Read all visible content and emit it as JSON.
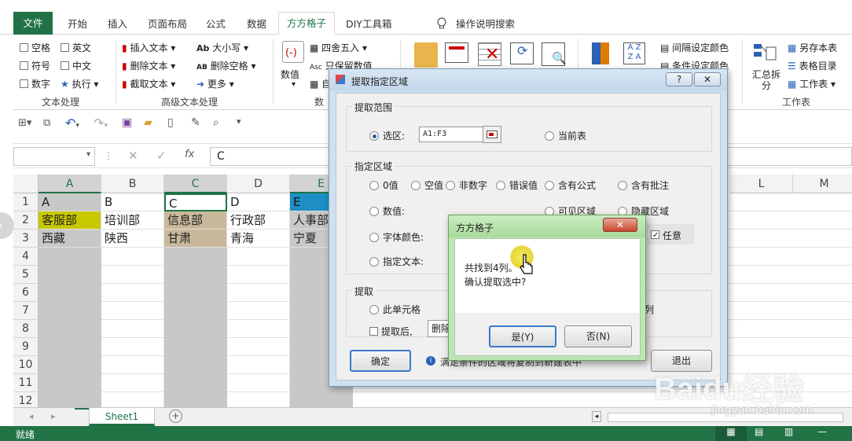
{
  "ribbon_tabs": {
    "file": "文件",
    "home": "开始",
    "insert": "插入",
    "layout": "页面布局",
    "formula": "公式",
    "data": "数据",
    "active": "方方格子",
    "diy": "DIY工具箱",
    "search": "操作说明搜索"
  },
  "ribbon": {
    "text_proc": {
      "space": "空格",
      "english": "英文",
      "symbol": "符号",
      "chinese": "中文",
      "number": "数字",
      "execute": "执行",
      "label": "文本处理"
    },
    "adv_text": {
      "insert_text": "插入文本",
      "delete_text": "删除文本",
      "cut_text": "截取文本",
      "case": "大小写",
      "delete_space": "删除空格",
      "more": "更多",
      "label": "高级文本处理"
    },
    "numeric": {
      "value": "数值",
      "round": "四舍五入",
      "keep_value": "只保留数值",
      "label_partial": "数",
      "auto_partial": "自"
    },
    "color": {
      "interval": "间隔设定颜色",
      "condition": "条件设定颜色"
    },
    "worksheet": {
      "summary": "汇总拆分",
      "save_as": "另存本表",
      "table_dir": "表格目录",
      "sheet": "工作表",
      "label": "工作表"
    }
  },
  "formula_bar": {
    "name_box": "",
    "value": "C",
    "fx": "fx"
  },
  "grid": {
    "columns": [
      "A",
      "B",
      "C",
      "D",
      "E",
      "L",
      "M"
    ],
    "rows": [
      "1",
      "2",
      "3",
      "4",
      "5",
      "6",
      "7",
      "8",
      "9",
      "10",
      "11",
      "12"
    ],
    "cells": {
      "A1": "A",
      "B1": "B",
      "C1": "C",
      "D1": "D",
      "E1": "E",
      "A2": "客服部",
      "B2": "培训部",
      "C2": "信息部",
      "D2": "行政部",
      "E2": "人事部",
      "A3": "西藏",
      "B3": "陕西",
      "C3": "甘肃",
      "D3": "青海",
      "E3": "宁夏"
    },
    "colors": {
      "yellow": "#c8c800",
      "tan": "#c9b99a",
      "gray": "#c8c8c8",
      "blue": "#1d8fc4"
    }
  },
  "sheet_tab": "Sheet1",
  "status": "就绪",
  "dialog": {
    "title": "提取指定区域",
    "range_group": "提取范围",
    "selection_label": "选区:",
    "selection_value": "A1:F3",
    "current_sheet": "当前表",
    "region_group": "指定区域",
    "options_row1": [
      "0值",
      "空值",
      "非数字",
      "错误值",
      "含有公式",
      "含有批注"
    ],
    "value_opt": "数值:",
    "visible_opt": "可见区域",
    "hidden_opt": "隐藏区域",
    "font_color_opt": "字体颜色:",
    "any_opt": "任意",
    "text_opt": "指定文本:",
    "extract_group": "提取",
    "this_cell": "此单元格",
    "col_partial": "列",
    "after_extract": "提取后,",
    "delete_partial": "删除",
    "ok": "确定",
    "exit": "退出",
    "info_text": "满足条件的区域将复制到新建表中"
  },
  "msgbox": {
    "title": "方方格子",
    "line1": "共找到4列。",
    "line2": "确认提取选中?",
    "yes": "是(Y)",
    "no": "否(N)"
  },
  "watermark": {
    "brand": "Baidu经验",
    "url": "jingyan.baidu.com"
  }
}
